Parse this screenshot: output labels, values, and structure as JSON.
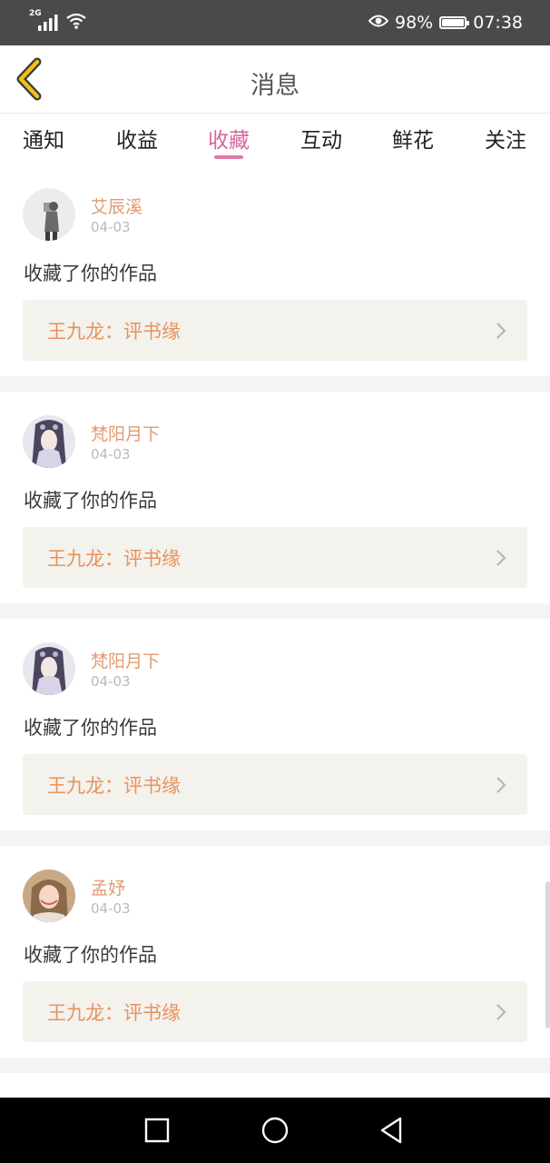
{
  "status_bar": {
    "network": "2G",
    "battery_percent": "98%",
    "battery_level": 0.98,
    "time": "07:38",
    "icons": [
      "signal-icon",
      "wifi-icon",
      "eye-icon",
      "battery-icon"
    ]
  },
  "header": {
    "title": "消息",
    "back_icon": "chevron-left-icon"
  },
  "tabs": [
    {
      "label": "通知"
    },
    {
      "label": "收益"
    },
    {
      "label": "收藏",
      "active": true
    },
    {
      "label": "互动"
    },
    {
      "label": "鲜花"
    },
    {
      "label": "关注"
    }
  ],
  "notifications": [
    {
      "user": "艾辰溪",
      "date": "04-03",
      "action": "收藏了你的作品",
      "work": "王九龙：评书缘"
    },
    {
      "user": "梵阳月下",
      "date": "04-03",
      "action": "收藏了你的作品",
      "work": "王九龙：评书缘"
    },
    {
      "user": "梵阳月下",
      "date": "04-03",
      "action": "收藏了你的作品",
      "work": "王九龙：评书缘"
    },
    {
      "user": "孟妤",
      "date": "04-03",
      "action": "收藏了你的作品",
      "work": "王九龙：评书缘"
    }
  ],
  "colors": {
    "accent_pink": "#d5679e",
    "username_orange": "#e29b73",
    "work_orange": "#e8925c",
    "back_arrow_yellow": "#ecc21a"
  },
  "nav_bar": {
    "icons": [
      "recent-apps-icon",
      "home-icon",
      "back-triangle-icon"
    ]
  }
}
